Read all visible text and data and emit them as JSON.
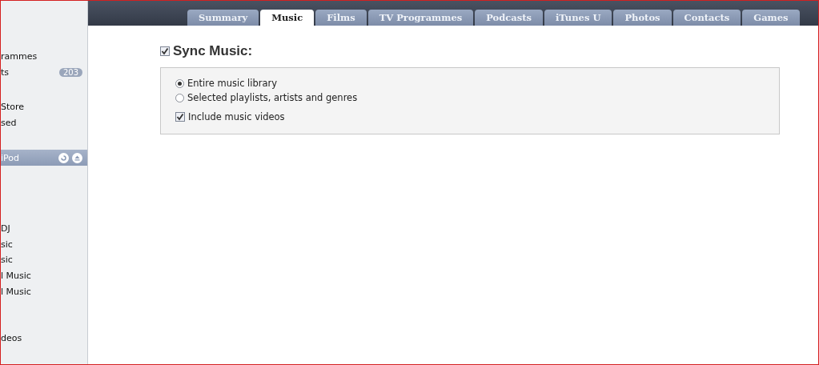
{
  "sidebar": {
    "groups": [
      {
        "items": [
          {
            "label": "rammes",
            "selected": false
          },
          {
            "label": "ts",
            "selected": false,
            "badge": "203"
          }
        ]
      },
      {
        "items": [
          {
            "label": "Store",
            "selected": false
          },
          {
            "label": "sed",
            "selected": false
          }
        ]
      },
      {
        "items": [
          {
            "label": "iPod",
            "selected": true,
            "device": true
          }
        ]
      },
      {
        "items": [
          {
            "label": "DJ",
            "selected": false
          },
          {
            "label": "sic",
            "selected": false
          },
          {
            "label": "sic",
            "selected": false
          },
          {
            "label": "l Music",
            "selected": false
          },
          {
            "label": "l Music",
            "selected": false
          }
        ]
      },
      {
        "items": [
          {
            "label": "deos",
            "selected": false
          }
        ]
      }
    ]
  },
  "tabs": [
    {
      "label": "Summary",
      "selected": false
    },
    {
      "label": "Music",
      "selected": true
    },
    {
      "label": "Films",
      "selected": false
    },
    {
      "label": "TV Programmes",
      "selected": false
    },
    {
      "label": "Podcasts",
      "selected": false
    },
    {
      "label": "iTunes U",
      "selected": false
    },
    {
      "label": "Photos",
      "selected": false
    },
    {
      "label": "Contacts",
      "selected": false
    },
    {
      "label": "Games",
      "selected": false
    }
  ],
  "sync": {
    "label": "Sync Music:",
    "checked": true
  },
  "options": [
    {
      "kind": "radio",
      "label": "Entire music library",
      "selected": true
    },
    {
      "kind": "radio",
      "label": "Selected playlists, artists and genres",
      "selected": false
    },
    {
      "kind": "checkbox",
      "label": "Include music videos",
      "checked": true
    }
  ]
}
